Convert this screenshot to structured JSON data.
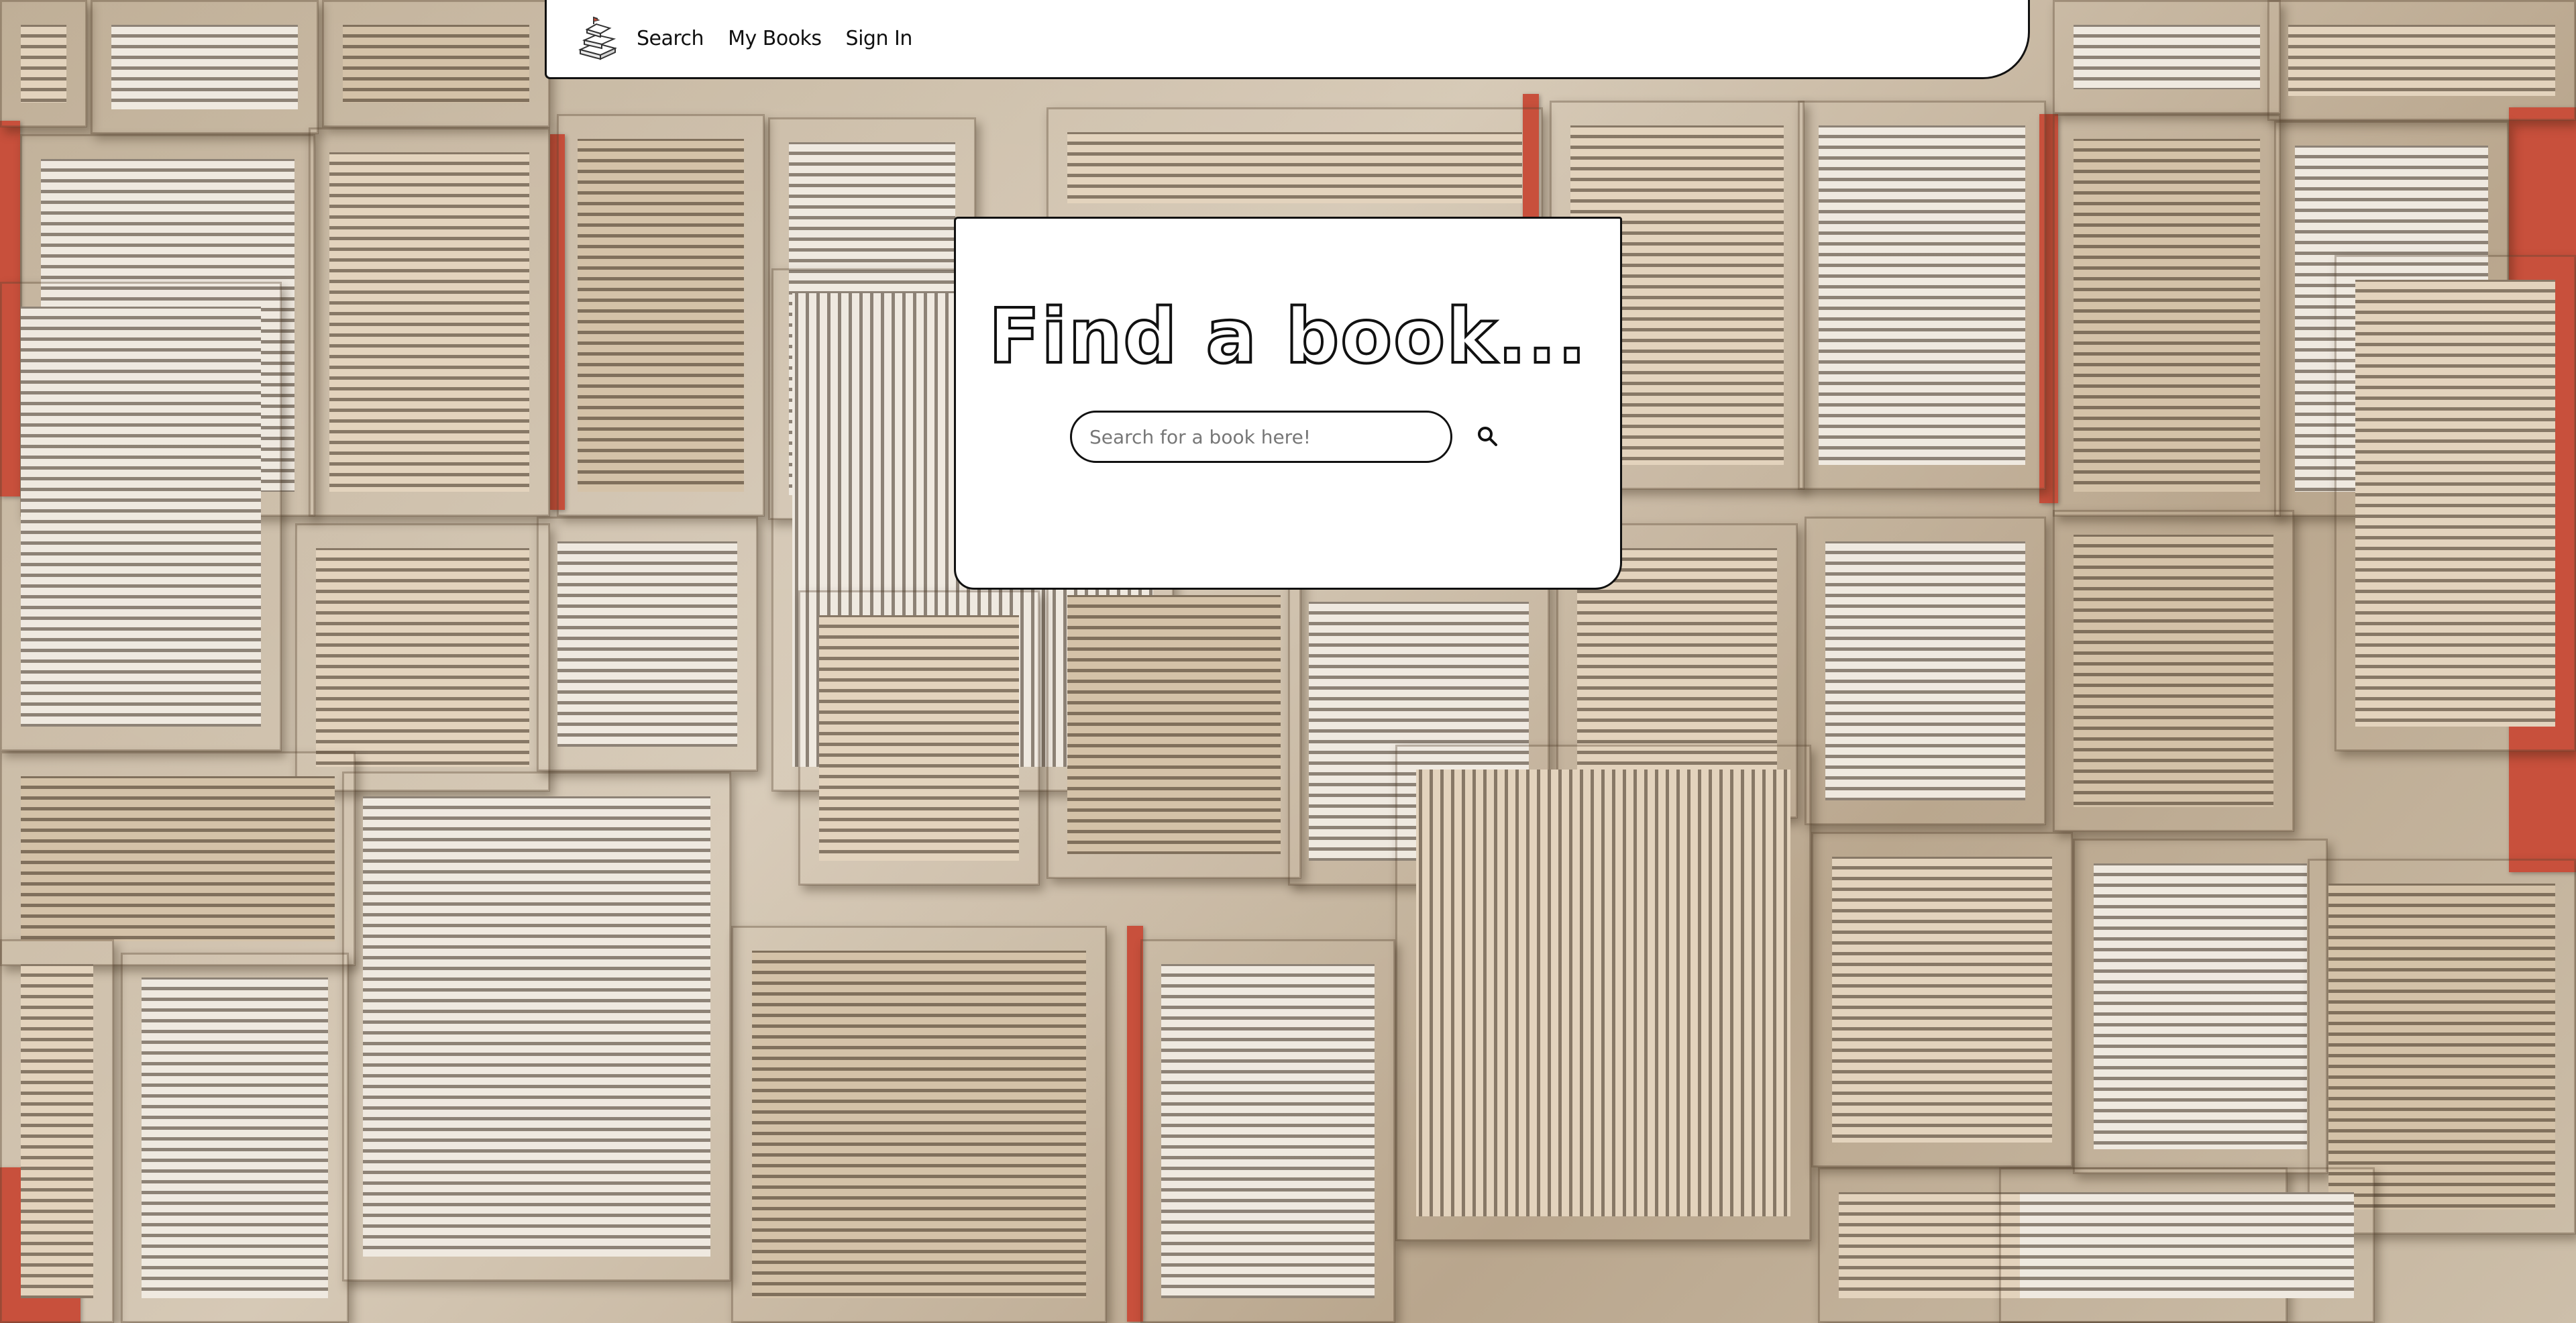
{
  "navbar": {
    "logo_icon": "books-logo-icon",
    "links": [
      {
        "label": "Search"
      },
      {
        "label": "My Books"
      },
      {
        "label": "Sign In"
      }
    ]
  },
  "search_card": {
    "heading": "Find a book...",
    "input_placeholder": "Search for a book here!",
    "input_value": "",
    "button_icon": "search-icon"
  },
  "colors": {
    "page_background": "#c9bca8",
    "card_background": "#ffffff",
    "border": "#111111",
    "accent_red": "#c8503c"
  }
}
